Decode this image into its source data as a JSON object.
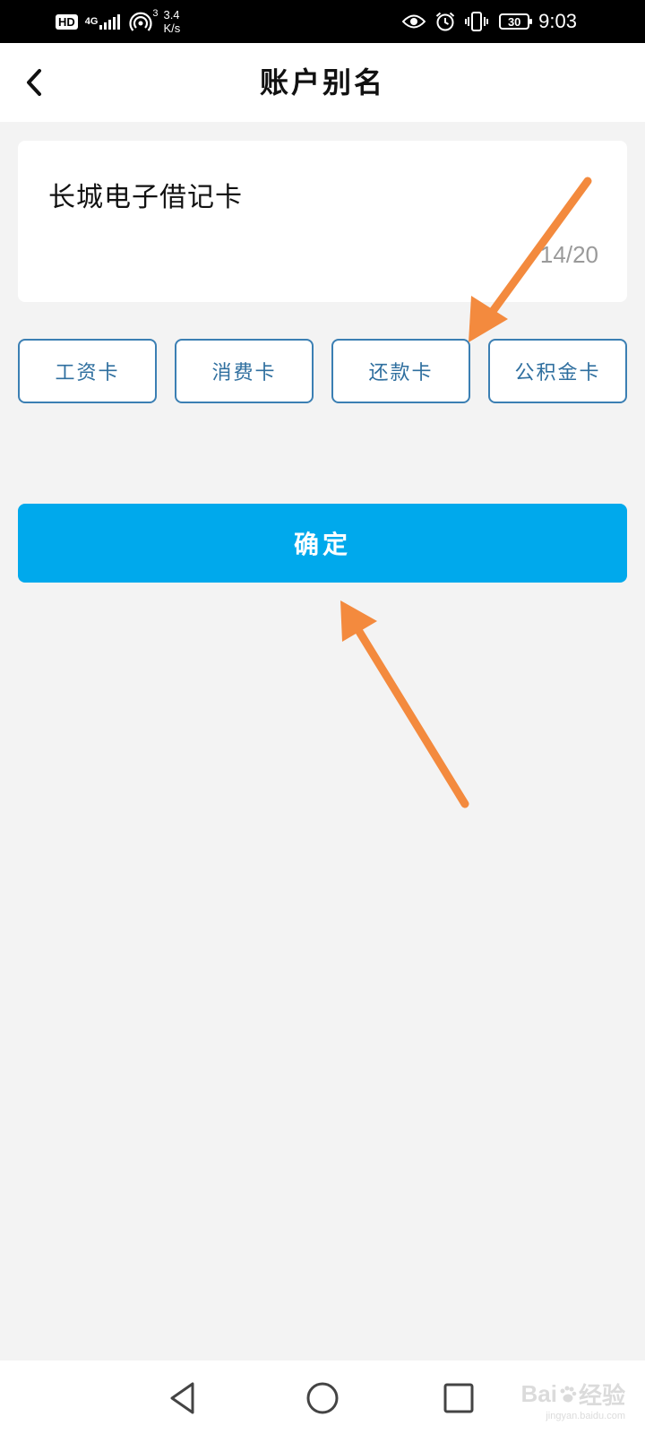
{
  "status_bar": {
    "hd": "HD",
    "network_type": "4G",
    "hotspot_count": "3",
    "speed_value": "3.4",
    "speed_unit": "K/s",
    "battery": "30",
    "time": "9:03",
    "icons": [
      "signal-icon",
      "hotspot-icon",
      "eye-icon",
      "alarm-icon",
      "vibrate-icon",
      "battery-icon"
    ]
  },
  "header": {
    "title": "账户别名",
    "back_icon": "chevron-left-icon"
  },
  "alias_input": {
    "value": "长城电子借记卡",
    "counter": "14/20"
  },
  "quick_aliases": [
    {
      "label": "工资卡"
    },
    {
      "label": "消费卡"
    },
    {
      "label": "还款卡"
    },
    {
      "label": "公积金卡"
    }
  ],
  "confirm": {
    "label": "确定"
  },
  "annotation_color": "#f38a3e",
  "accent_color": "#00a9ec",
  "chip_border_color": "#3b7fb3",
  "nav_bar": {
    "icons": [
      "back-triangle-icon",
      "home-circle-icon",
      "recents-square-icon"
    ]
  },
  "watermark": {
    "brand": "Bai",
    "brand2": "经验",
    "url": "jingyan.baidu.com"
  }
}
